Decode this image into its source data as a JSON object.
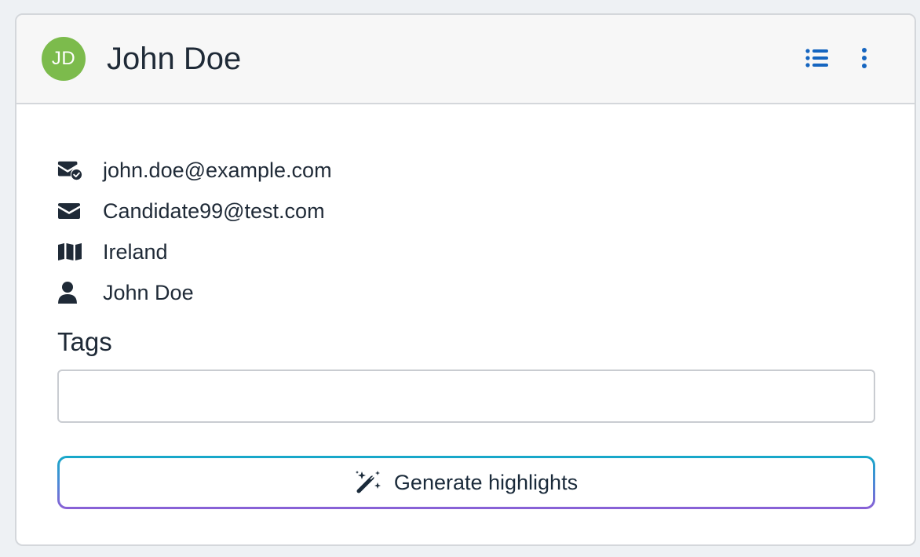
{
  "header": {
    "avatar_initials": "JD",
    "name": "John Doe",
    "icons": {
      "list": "list-icon",
      "more": "vertical-ellipsis-icon"
    }
  },
  "contact": {
    "items": [
      {
        "icon": "envelope-check-icon",
        "text": "john.doe@example.com"
      },
      {
        "icon": "envelope-icon",
        "text": "Candidate99@test.com"
      },
      {
        "icon": "map-icon",
        "text": "Ireland"
      },
      {
        "icon": "user-icon",
        "text": "John Doe"
      }
    ]
  },
  "tags": {
    "label": "Tags",
    "value": "",
    "placeholder": ""
  },
  "actions": {
    "generate_label": "Generate highlights",
    "generate_icon": "magic-wand-icon"
  },
  "colors": {
    "avatar": "#7cbb4c",
    "accent": "#1565c0",
    "gradient_top": "#15a9c9",
    "gradient_bottom": "#8b5fd6"
  }
}
